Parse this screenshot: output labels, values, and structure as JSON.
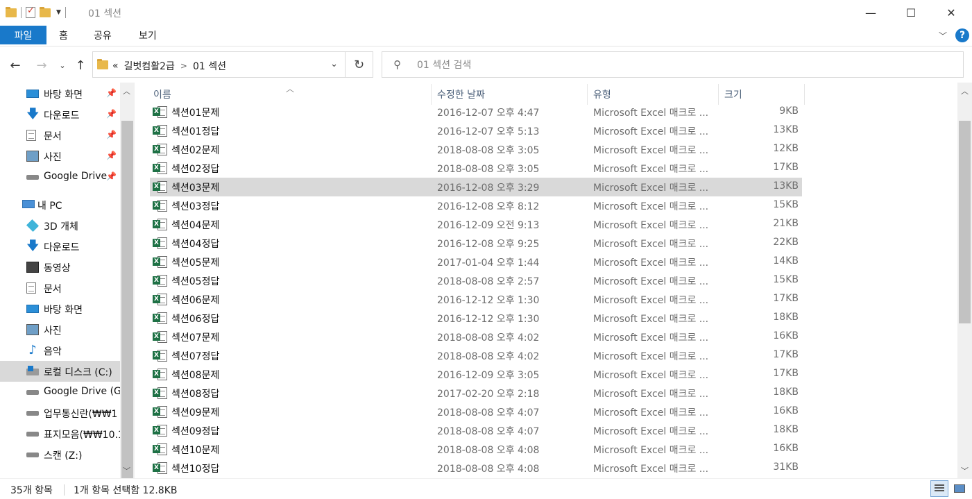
{
  "window": {
    "title": "01 섹션",
    "controls": {
      "minimize": "—",
      "maximize": "☐",
      "close": "✕"
    }
  },
  "ribbon": {
    "file_tab": "파일",
    "tabs": [
      "홈",
      "공유",
      "보기"
    ],
    "help": "?"
  },
  "address": {
    "overflow": "«",
    "crumbs": [
      "길벗컴활2급",
      "01 섹션"
    ],
    "separator": ">"
  },
  "search": {
    "placeholder": "01 섹션 검색"
  },
  "nav_pane": {
    "items": [
      {
        "label": "바탕 화면",
        "icon": "desktop-icon",
        "pinned": true
      },
      {
        "label": "다운로드",
        "icon": "download-icon",
        "pinned": true
      },
      {
        "label": "문서",
        "icon": "document-icon",
        "pinned": true
      },
      {
        "label": "사진",
        "icon": "pictures-icon",
        "pinned": true
      },
      {
        "label": "Google Drive",
        "icon": "drive-icon",
        "pinned": true
      },
      {
        "label": "내 PC",
        "icon": "pc-icon",
        "pinned": false
      },
      {
        "label": "3D 개체",
        "icon": "3d-objects-icon",
        "pinned": false
      },
      {
        "label": "다운로드",
        "icon": "download-icon",
        "pinned": false
      },
      {
        "label": "동영상",
        "icon": "video-icon",
        "pinned": false
      },
      {
        "label": "문서",
        "icon": "document-icon",
        "pinned": false
      },
      {
        "label": "바탕 화면",
        "icon": "desktop-icon",
        "pinned": false
      },
      {
        "label": "사진",
        "icon": "pictures-icon",
        "pinned": false
      },
      {
        "label": "음악",
        "icon": "music-icon",
        "pinned": false
      },
      {
        "label": "로컬 디스크 (C:)",
        "icon": "local-disk-icon",
        "pinned": false,
        "selected": true
      },
      {
        "label": "Google Drive (G",
        "icon": "drive-icon",
        "pinned": false
      },
      {
        "label": "업무통신란(₩₩1",
        "icon": "network-drive-icon",
        "pinned": false
      },
      {
        "label": "표지모음(₩₩10.1",
        "icon": "network-drive-icon",
        "pinned": false
      },
      {
        "label": "스캔 (Z:)",
        "icon": "network-drive-icon",
        "pinned": false
      }
    ]
  },
  "columns": {
    "name": "이름",
    "modified": "수정한 날짜",
    "type": "유형",
    "size": "크기"
  },
  "files": [
    {
      "name": "섹션01문제",
      "modified": "2016-12-07 오후 4:47",
      "type": "Microsoft Excel 매크로 ...",
      "size": "9KB"
    },
    {
      "name": "섹션01정답",
      "modified": "2016-12-07 오후 5:13",
      "type": "Microsoft Excel 매크로 ...",
      "size": "13KB"
    },
    {
      "name": "섹션02문제",
      "modified": "2018-08-08 오후 3:05",
      "type": "Microsoft Excel 매크로 ...",
      "size": "12KB"
    },
    {
      "name": "섹션02정답",
      "modified": "2018-08-08 오후 3:05",
      "type": "Microsoft Excel 매크로 ...",
      "size": "17KB"
    },
    {
      "name": "섹션03문제",
      "modified": "2016-12-08 오후 3:29",
      "type": "Microsoft Excel 매크로 ...",
      "size": "13KB",
      "selected": true
    },
    {
      "name": "섹션03정답",
      "modified": "2016-12-08 오후 8:12",
      "type": "Microsoft Excel 매크로 ...",
      "size": "15KB"
    },
    {
      "name": "섹션04문제",
      "modified": "2016-12-09 오전 9:13",
      "type": "Microsoft Excel 매크로 ...",
      "size": "21KB"
    },
    {
      "name": "섹션04정답",
      "modified": "2016-12-08 오후 9:25",
      "type": "Microsoft Excel 매크로 ...",
      "size": "22KB"
    },
    {
      "name": "섹션05문제",
      "modified": "2017-01-04 오후 1:44",
      "type": "Microsoft Excel 매크로 ...",
      "size": "14KB"
    },
    {
      "name": "섹션05정답",
      "modified": "2018-08-08 오후 2:57",
      "type": "Microsoft Excel 매크로 ...",
      "size": "15KB"
    },
    {
      "name": "섹션06문제",
      "modified": "2016-12-12 오후 1:30",
      "type": "Microsoft Excel 매크로 ...",
      "size": "17KB"
    },
    {
      "name": "섹션06정답",
      "modified": "2016-12-12 오후 1:30",
      "type": "Microsoft Excel 매크로 ...",
      "size": "18KB"
    },
    {
      "name": "섹션07문제",
      "modified": "2018-08-08 오후 4:02",
      "type": "Microsoft Excel 매크로 ...",
      "size": "16KB"
    },
    {
      "name": "섹션07정답",
      "modified": "2018-08-08 오후 4:02",
      "type": "Microsoft Excel 매크로 ...",
      "size": "17KB"
    },
    {
      "name": "섹션08문제",
      "modified": "2016-12-09 오후 3:05",
      "type": "Microsoft Excel 매크로 ...",
      "size": "17KB"
    },
    {
      "name": "섹션08정답",
      "modified": "2017-02-20 오후 2:18",
      "type": "Microsoft Excel 매크로 ...",
      "size": "18KB"
    },
    {
      "name": "섹션09문제",
      "modified": "2018-08-08 오후 4:07",
      "type": "Microsoft Excel 매크로 ...",
      "size": "16KB"
    },
    {
      "name": "섹션09정답",
      "modified": "2018-08-08 오후 4:07",
      "type": "Microsoft Excel 매크로 ...",
      "size": "18KB"
    },
    {
      "name": "섹션10문제",
      "modified": "2018-08-08 오후 4:08",
      "type": "Microsoft Excel 매크로 ...",
      "size": "16KB"
    },
    {
      "name": "섹션10정답",
      "modified": "2018-08-08 오후 4:08",
      "type": "Microsoft Excel 매크로 ...",
      "size": "31KB"
    }
  ],
  "status": {
    "item_count": "35개 항목",
    "selection": "1개 항목 선택함 12.8KB"
  },
  "colors": {
    "accent": "#1979ca",
    "selection": "#d9d9d9",
    "excel_green": "#1e7145",
    "header_text": "#4c607a"
  }
}
